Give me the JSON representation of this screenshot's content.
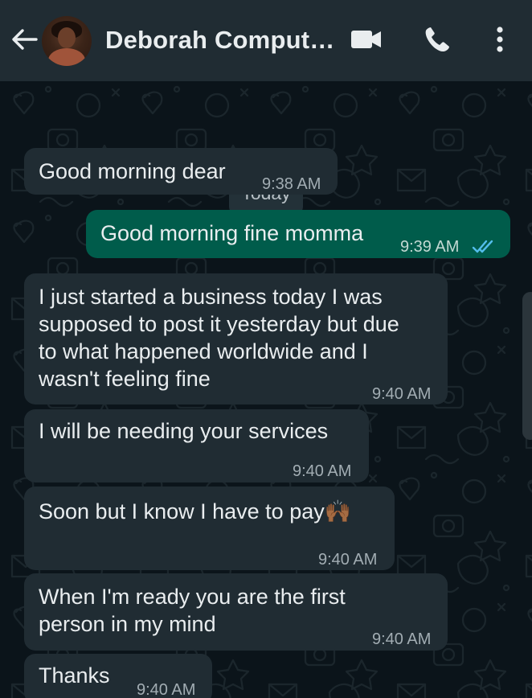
{
  "header": {
    "contact_name": "Deborah Comput…",
    "back_icon": "arrow-left-icon",
    "video_icon": "video-camera-icon",
    "call_icon": "phone-icon",
    "menu_icon": "more-vertical-icon",
    "bg_color": "#202c33"
  },
  "chat": {
    "date_chip": "Today",
    "messages": [
      {
        "direction": "incoming",
        "text": "Good morning dear",
        "time": "9:38 AM"
      },
      {
        "direction": "outgoing",
        "text": "Good morning fine momma",
        "time": "9:39 AM",
        "status": "read-double-tick-icon"
      },
      {
        "direction": "incoming",
        "text": "I just started a business today I was\nsupposed to post it yesterday but due\nto what happened worldwide and I\nwasn't feeling fine",
        "time": "9:40 AM"
      },
      {
        "direction": "incoming",
        "text": "I will be needing your services",
        "time": "9:40 AM"
      },
      {
        "direction": "incoming",
        "text": "Soon but I know I have to pay🙌🏾",
        "time": "9:40 AM"
      },
      {
        "direction": "incoming",
        "text": "When I'm ready you are the first\nperson in my mind",
        "time": "9:40 AM"
      },
      {
        "direction": "incoming",
        "text": "Thanks",
        "time": "9:40 AM"
      }
    ]
  },
  "colors": {
    "incoming_bubble": "#202c33",
    "outgoing_bubble": "#005c4b",
    "read_tick": "#53bdeb",
    "background": "#0b141a"
  }
}
